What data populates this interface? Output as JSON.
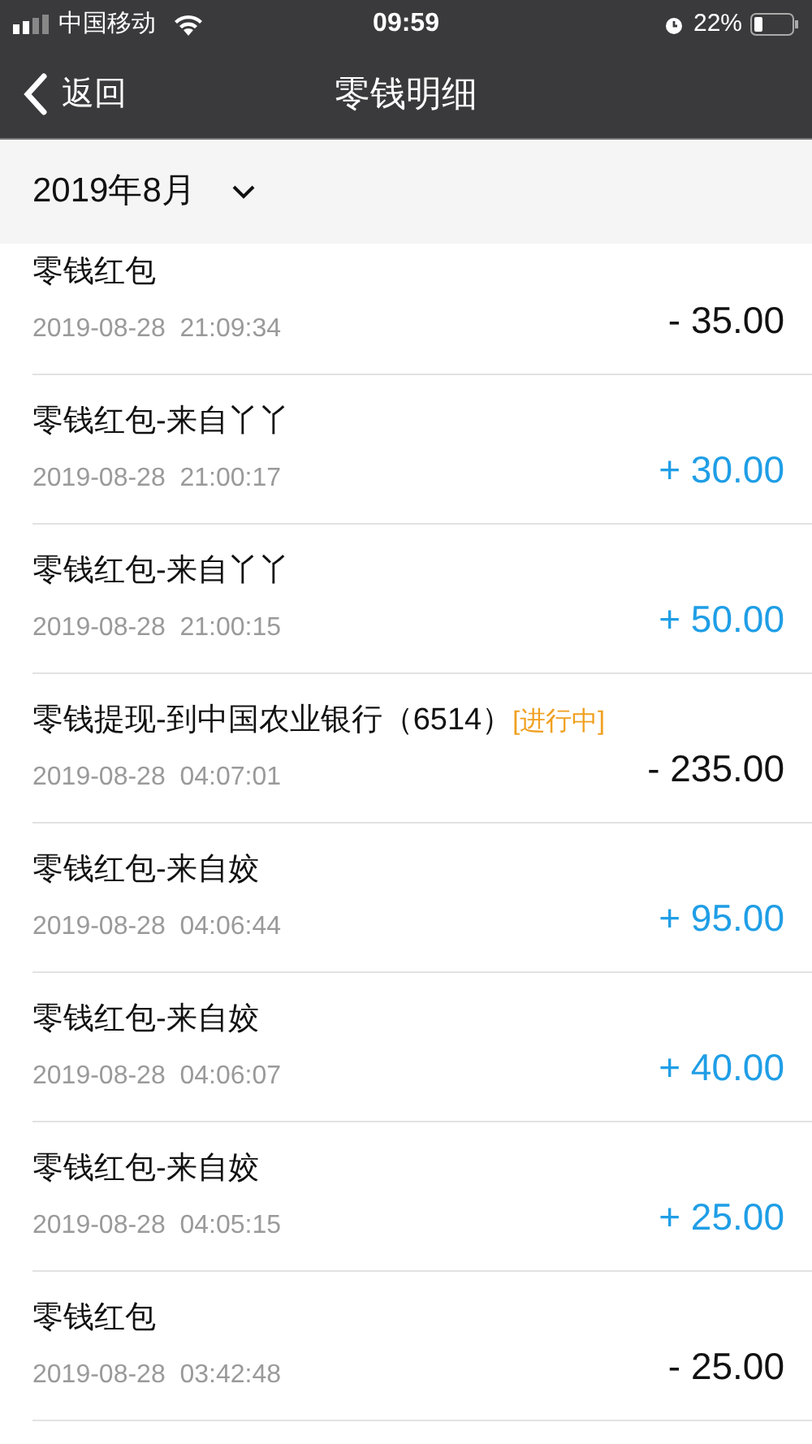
{
  "status_bar": {
    "carrier": "中国移动",
    "time": "09:59",
    "battery": "22%"
  },
  "nav": {
    "back": "返回",
    "title": "零钱明细"
  },
  "month_filter": {
    "label": "2019年8月"
  },
  "transactions": [
    {
      "title": "零钱红包",
      "time": "2019-08-28  21:09:34",
      "amount": "- 35.00",
      "kind": "expense"
    },
    {
      "title": "零钱红包-来自丫丫",
      "time": "2019-08-28  21:00:17",
      "amount": "+ 30.00",
      "kind": "income"
    },
    {
      "title": "零钱红包-来自丫丫",
      "time": "2019-08-28  21:00:15",
      "amount": "+ 50.00",
      "kind": "income"
    },
    {
      "title": "零钱提现-到中国农业银行（6514）",
      "status": "[进行中]",
      "time": "2019-08-28  04:07:01",
      "amount": "- 235.00",
      "kind": "expense"
    },
    {
      "title": "零钱红包-来自姣",
      "time": "2019-08-28  04:06:44",
      "amount": "+ 95.00",
      "kind": "income"
    },
    {
      "title": "零钱红包-来自姣",
      "time": "2019-08-28  04:06:07",
      "amount": "+ 40.00",
      "kind": "income"
    },
    {
      "title": "零钱红包-来自姣",
      "time": "2019-08-28  04:05:15",
      "amount": "+ 25.00",
      "kind": "income"
    },
    {
      "title": "零钱红包",
      "time": "2019-08-28  03:42:48",
      "amount": "- 25.00",
      "kind": "expense"
    }
  ]
}
